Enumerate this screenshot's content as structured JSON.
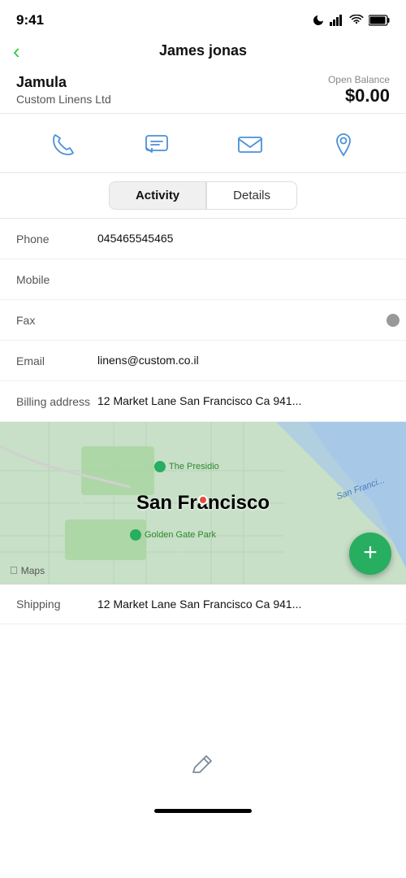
{
  "statusBar": {
    "time": "9:41",
    "moonIcon": "moon-icon"
  },
  "nav": {
    "backLabel": "‹",
    "title": "James jonas"
  },
  "contact": {
    "name": "Jamula",
    "company": "Custom Linens Ltd",
    "balanceLabel": "Open Balance",
    "balanceAmount": "$0.00"
  },
  "actions": [
    {
      "name": "phone-icon",
      "label": "Phone"
    },
    {
      "name": "message-icon",
      "label": "Message"
    },
    {
      "name": "email-icon",
      "label": "Email"
    },
    {
      "name": "location-icon",
      "label": "Location"
    }
  ],
  "tabs": [
    {
      "id": "activity",
      "label": "Activity",
      "active": false
    },
    {
      "id": "details",
      "label": "Details",
      "active": true
    }
  ],
  "fields": [
    {
      "label": "Phone",
      "value": "045465545465",
      "empty": false
    },
    {
      "label": "Mobile",
      "value": "",
      "empty": true
    },
    {
      "label": "Fax",
      "value": "",
      "empty": true
    },
    {
      "label": "Email",
      "value": "linens@custom.co.il",
      "empty": false
    },
    {
      "label": "Billing address",
      "value": "12 Market Lane San Francisco Ca 941...",
      "empty": false
    }
  ],
  "map": {
    "cityLabel": "San Francisco",
    "presioLabel": "The Presidio",
    "ggpLabel": "Golden Gate Park",
    "bayLabel": "San Franci...",
    "mapsLabel": "Maps"
  },
  "shipping": {
    "label": "Shipping",
    "value": "12 Market Lane  San Francisco  Ca 941..."
  },
  "editIcon": "pencil-icon",
  "fab": {
    "label": "+"
  }
}
